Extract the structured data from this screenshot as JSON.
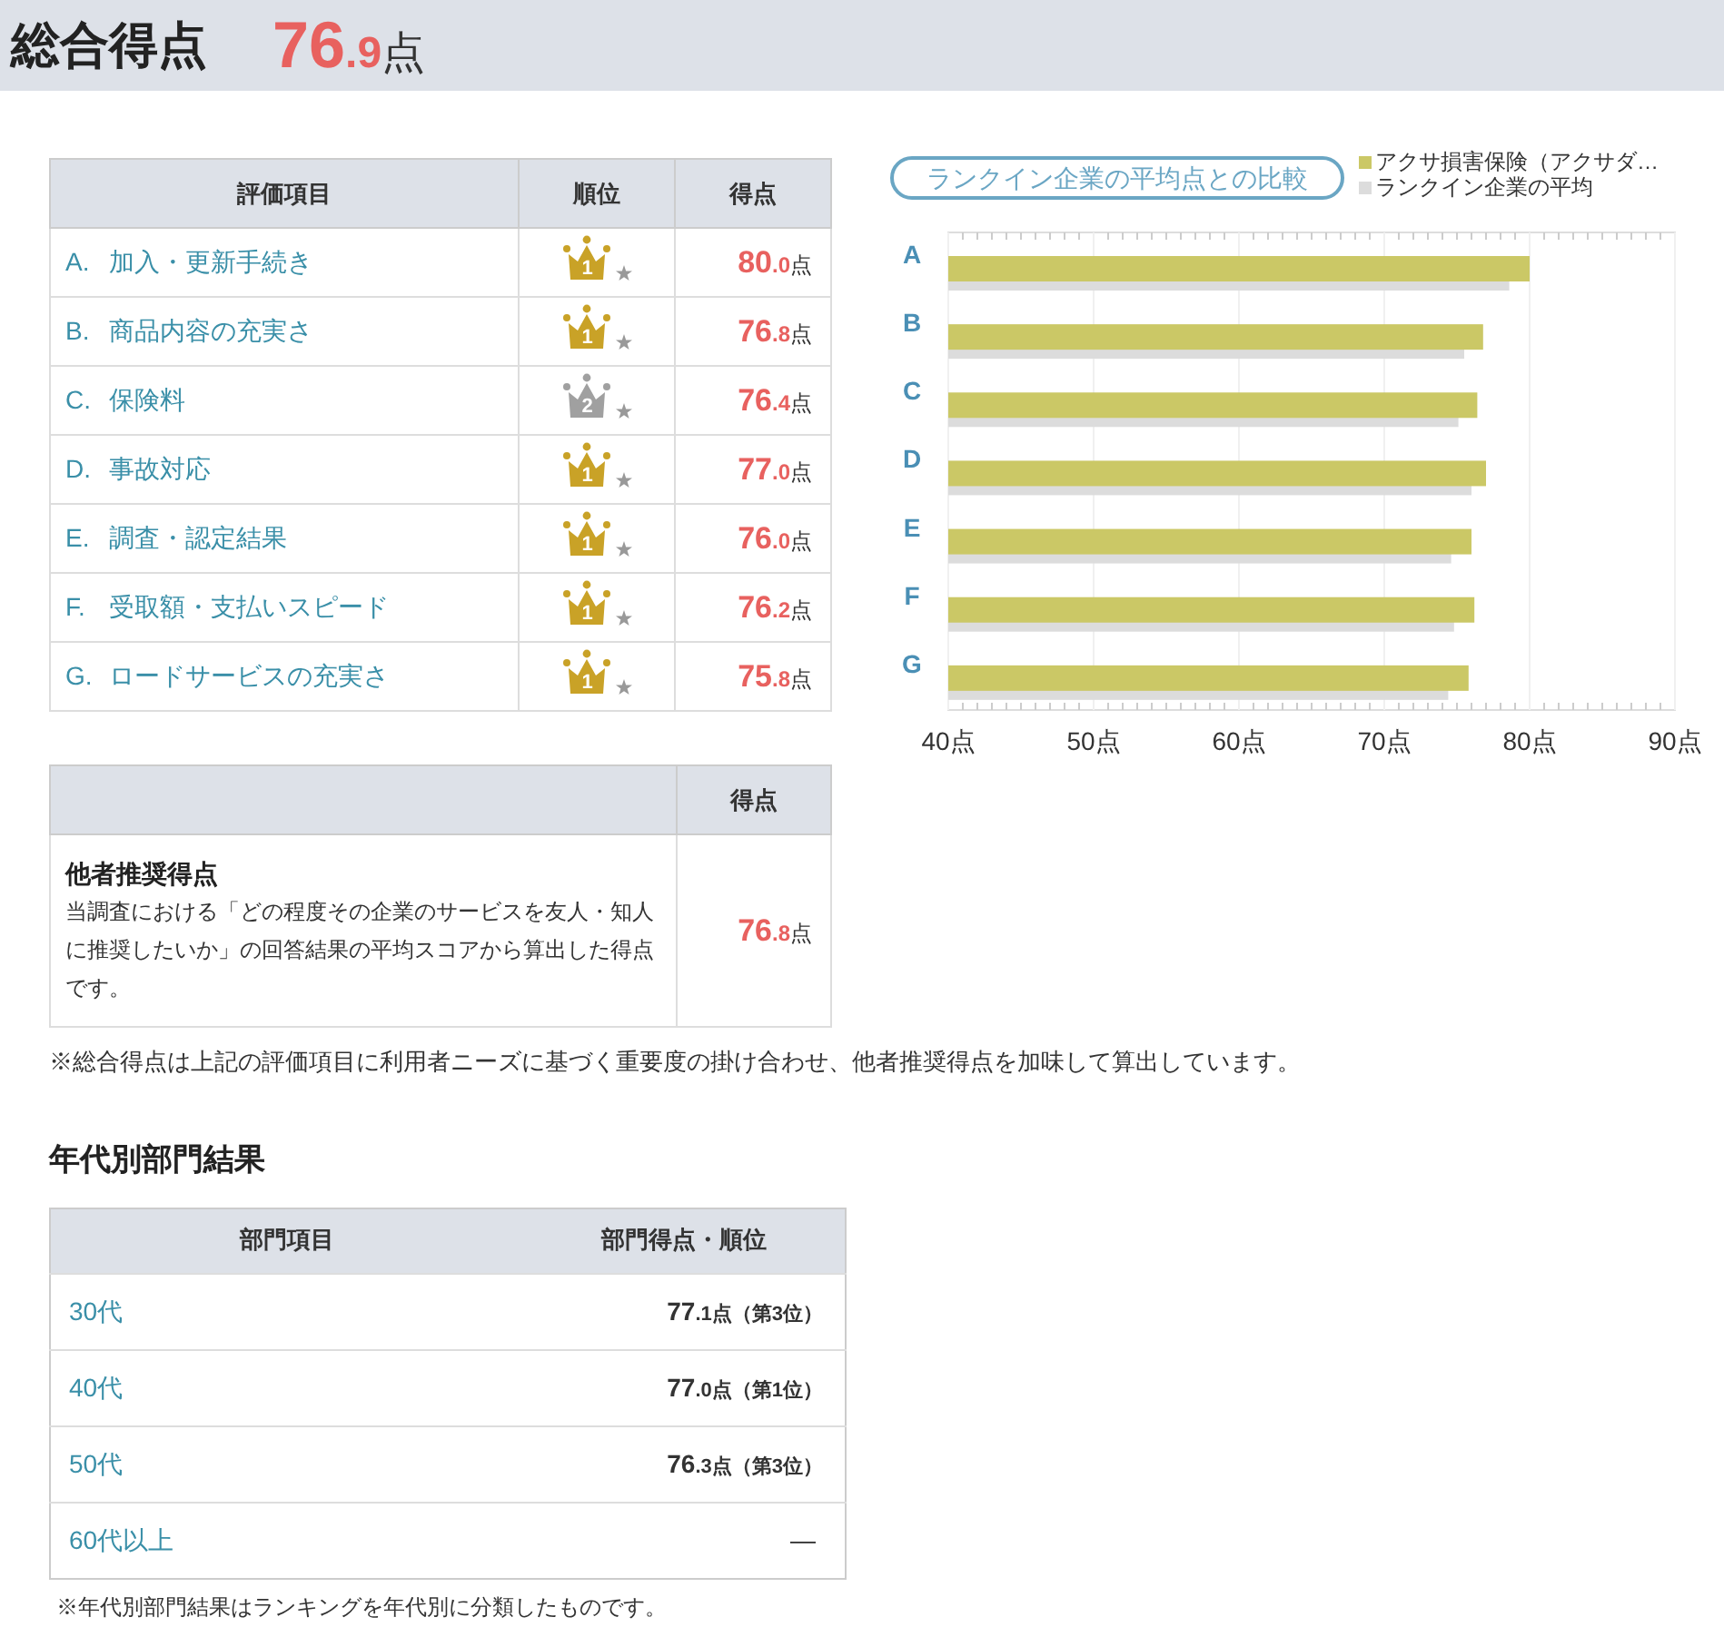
{
  "header": {
    "title": "総合得点",
    "score": {
      "main": "76",
      "decimal": ".9",
      "unit": "点"
    }
  },
  "eval_table": {
    "columns": [
      "評価項目",
      "順位",
      "得点"
    ],
    "rows": [
      {
        "letter": "A.",
        "label": "加入・更新手続き",
        "color": "#c9a227",
        "rank": "1",
        "score": {
          "main": "80",
          "decimal": ".0",
          "unit": "点"
        }
      },
      {
        "letter": "B.",
        "label": "商品内容の充実さ",
        "color": "#c9a227",
        "rank": "1",
        "score": {
          "main": "76",
          "decimal": ".8",
          "unit": "点"
        }
      },
      {
        "letter": "C.",
        "label": "保険料",
        "color": "#a0a0a0",
        "rank": "2",
        "score": {
          "main": "76",
          "decimal": ".4",
          "unit": "点"
        }
      },
      {
        "letter": "D.",
        "label": "事故対応",
        "color": "#c9a227",
        "rank": "1",
        "score": {
          "main": "77",
          "decimal": ".0",
          "unit": "点"
        }
      },
      {
        "letter": "E.",
        "label": "調査・認定結果",
        "color": "#c9a227",
        "rank": "1",
        "score": {
          "main": "76",
          "decimal": ".0",
          "unit": "点"
        }
      },
      {
        "letter": "F.",
        "label": "受取額・支払いスピード",
        "color": "#c9a227",
        "rank": "1",
        "score": {
          "main": "76",
          "decimal": ".2",
          "unit": "点"
        }
      },
      {
        "letter": "G.",
        "label": "ロードサービスの充実さ",
        "color": "#c9a227",
        "rank": "1",
        "score": {
          "main": "75",
          "decimal": ".8",
          "unit": "点"
        }
      }
    ]
  },
  "recommend_table": {
    "column": "得点",
    "title": "他者推奨得点",
    "description": "当調査における「どの程度その企業のサービスを友人・知人に推奨したいか」の回答結果の平均スコアから算出した得点です。",
    "score": {
      "main": "76",
      "decimal": ".8",
      "unit": "点"
    }
  },
  "note": "※総合得点は上記の評価項目に利用者ニーズに基づく重要度の掛け合わせ、他者推奨得点を加味して算出しています。",
  "comparison": {
    "title": "ランクイン企業の平均点との比較",
    "chart_data": {
      "type": "bar",
      "orientation": "horizontal",
      "grid": true,
      "categories": [
        "A",
        "B",
        "C",
        "D",
        "E",
        "F",
        "G"
      ],
      "series": [
        {
          "name": "アクサ損害保険（アクサダ…",
          "color": "#cbc866",
          "values": [
            80.0,
            76.8,
            76.4,
            77.0,
            76.0,
            76.2,
            75.8
          ]
        },
        {
          "name": "ランクイン企業の平均",
          "color": "#dcdcdc",
          "values": [
            78.6,
            75.5,
            75.1,
            76.0,
            74.6,
            74.8,
            74.4
          ]
        }
      ],
      "xlim": [
        40,
        90
      ],
      "xticks": [
        {
          "value": 40,
          "label": "40点"
        },
        {
          "value": 50,
          "label": "50点"
        },
        {
          "value": 60,
          "label": "60点"
        },
        {
          "value": 70,
          "label": "70点"
        },
        {
          "value": 80,
          "label": "80点"
        },
        {
          "value": 90,
          "label": "90点"
        }
      ]
    }
  },
  "age_section": {
    "heading": "年代別部門結果",
    "columns": [
      "部門項目",
      "部門得点・順位"
    ],
    "rows": [
      {
        "label": "30代",
        "kind": "score",
        "main": "77",
        "decimal": ".1",
        "unit": "点",
        "rank": "（第3位）"
      },
      {
        "label": "40代",
        "kind": "score",
        "main": "77",
        "decimal": ".0",
        "unit": "点",
        "rank": "（第1位）"
      },
      {
        "label": "50代",
        "kind": "score",
        "main": "76",
        "decimal": ".3",
        "unit": "点",
        "rank": "（第3位）"
      },
      {
        "label": "60代以上",
        "kind": "none",
        "text": "—"
      }
    ],
    "note": "※年代別部門結果はランキングを年代別に分類したものです。"
  }
}
